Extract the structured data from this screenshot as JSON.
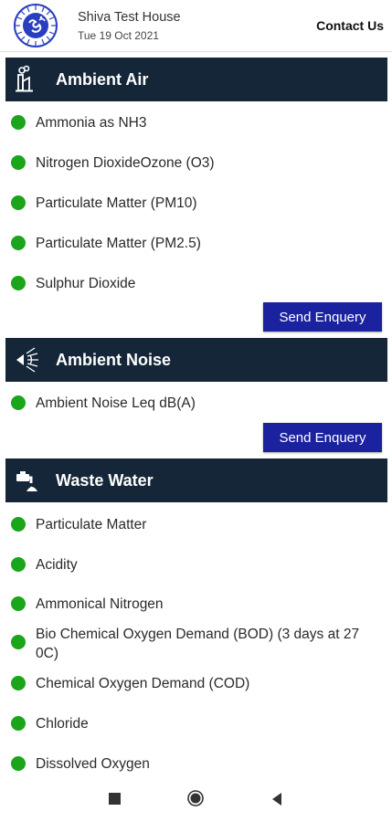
{
  "header": {
    "app_name": "Shiva Test House",
    "date": "Tue 19 Oct 2021",
    "contact_label": "Contact Us"
  },
  "sections": [
    {
      "title": "Ambient Air",
      "icon": "factory-icon",
      "items": [
        "Ammonia as NH3",
        "Nitrogen DioxideOzone (O3)",
        "Particulate Matter (PM10)",
        "Particulate Matter (PM2.5)",
        "Sulphur Dioxide"
      ],
      "button_label": "Send Enquery"
    },
    {
      "title": "Ambient Noise",
      "icon": "speaker-icon",
      "items": [
        "Ambient Noise Leq dB(A)"
      ],
      "button_label": "Send Enquery"
    },
    {
      "title": "Waste Water",
      "icon": "water-tap-icon",
      "items": [
        "Particulate Matter",
        "Acidity",
        "Ammonical Nitrogen",
        "Bio Chemical Oxygen Demand (BOD) (3 days at 27",
        "0C)",
        "Chemical Oxygen Demand (COD)",
        "Chloride",
        "Dissolved Oxygen"
      ]
    }
  ],
  "colors": {
    "section_header_bg": "#142638",
    "status_dot": "#1aa51a",
    "button_bg": "#1a22a0"
  }
}
